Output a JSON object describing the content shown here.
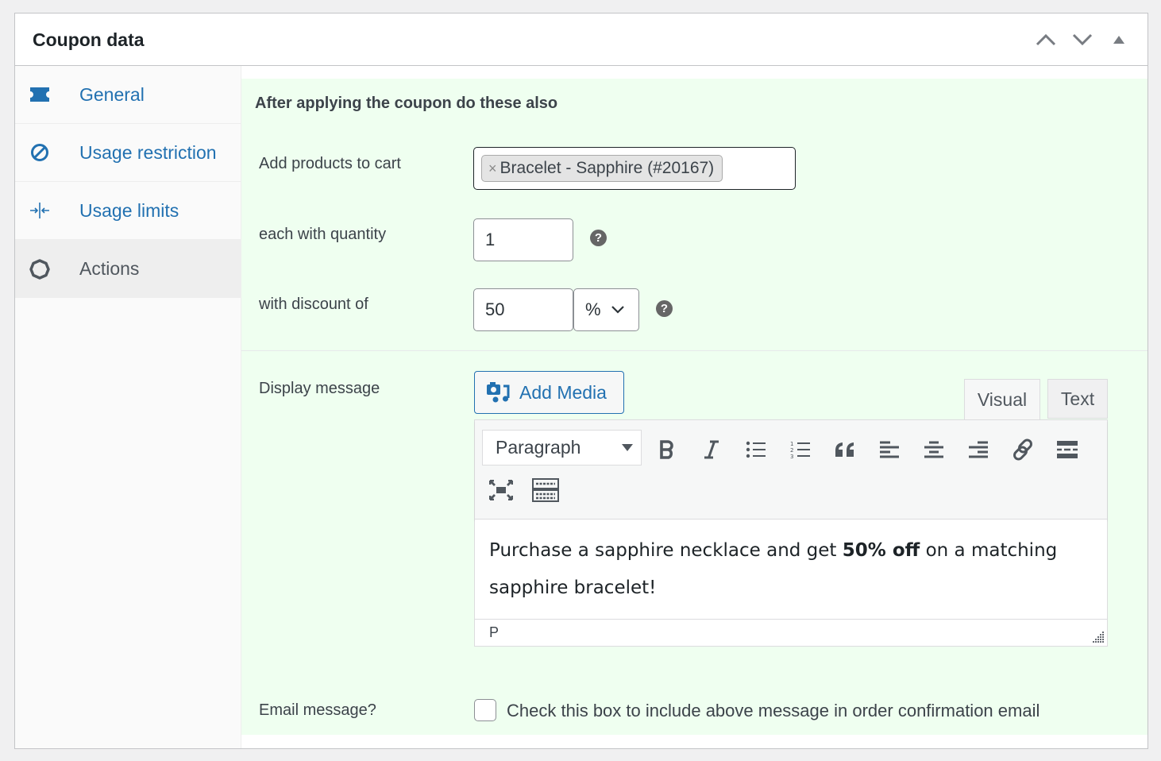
{
  "postbox": {
    "title": "Coupon data",
    "handle_actions": [
      {
        "name": "move-up",
        "icon": "chevron-up-icon"
      },
      {
        "name": "move-down",
        "icon": "chevron-down-icon"
      },
      {
        "name": "toggle-panel",
        "icon": "triangle-up-icon"
      }
    ]
  },
  "tabs": [
    {
      "label": "General",
      "icon": "ticket-icon",
      "active": false
    },
    {
      "label": "Usage restriction",
      "icon": "block-icon",
      "active": false
    },
    {
      "label": "Usage limits",
      "icon": "limits-icon",
      "active": false
    },
    {
      "label": "Actions",
      "icon": "gear-icon",
      "active": true
    }
  ],
  "actions_panel": {
    "heading": "After applying the coupon do these also",
    "add_products": {
      "label": "Add products to cart",
      "selected": [
        {
          "label": "Bracelet - Sapphire (#20167)",
          "remove": "×"
        }
      ]
    },
    "quantity": {
      "label": "each with quantity",
      "value": "1",
      "help": "?"
    },
    "discount": {
      "label": "with discount of",
      "value": "50",
      "type_selected": "%",
      "help": "?"
    },
    "display_message": {
      "label": "Display message",
      "add_media_label": "Add Media",
      "tabs": {
        "visual": "Visual",
        "text": "Text"
      },
      "active_tab": "Visual",
      "format_select": "Paragraph",
      "toolbar": [
        "bold-icon",
        "italic-icon",
        "bullet-list-icon",
        "numbered-list-icon",
        "blockquote-icon",
        "align-left-icon",
        "align-center-icon",
        "align-right-icon",
        "link-icon",
        "read-more-icon",
        "fullscreen-icon",
        "toolbar-toggle-icon"
      ],
      "content": {
        "before": "Purchase a sapphire necklace and get ",
        "bold": "50% off",
        "after": " on a matching sapphire bracelet!"
      },
      "path": "P"
    },
    "email_message": {
      "label": "Email message?",
      "checkbox_label": "Check this box to include above message in order confirmation email",
      "checked": false
    }
  }
}
